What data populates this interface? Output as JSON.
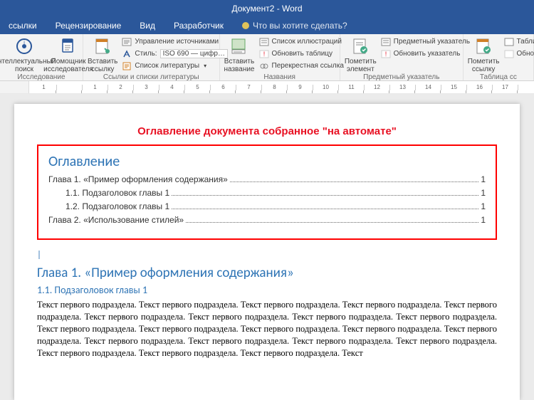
{
  "titlebar": {
    "text": "Документ2 - Word"
  },
  "tabs": {
    "links": "ссылки",
    "review": "Рецензирование",
    "view": "Вид",
    "developer": "Разработчик",
    "tellme": "Что вы хотите сделать?"
  },
  "ribbon": {
    "research": {
      "title": "Исследование",
      "smart_lookup": "Интеллектуальный\nпоиск",
      "researcher": "Помощник\nисследователя"
    },
    "citations": {
      "title": "Ссылки и списки литературы",
      "insert_citation": "Вставить\nссылку",
      "manage_sources": "Управление источниками",
      "style_label": "Стиль:",
      "style_value": "ISO 690 — цифр…",
      "bibliography": "Список литературы"
    },
    "captions": {
      "title": "Названия",
      "insert_caption": "Вставить\nназвание",
      "table_of_figures": "Список иллюстраций",
      "update_table": "Обновить таблицу",
      "cross_ref": "Перекрестная ссылка"
    },
    "index": {
      "title": "Предметный указатель",
      "mark_entry": "Пометить\nэлемент",
      "insert_index": "Предметный указатель",
      "update_index": "Обновить указатель"
    },
    "authorities": {
      "title": "Таблица сс",
      "mark_citation": "Пометить\nссылку",
      "insert_toa": "Табли",
      "update_toa": "Обно"
    }
  },
  "ruler": [
    "1",
    "",
    "1",
    "2",
    "3",
    "4",
    "5",
    "6",
    "7",
    "8",
    "9",
    "10",
    "11",
    "12",
    "13",
    "14",
    "15",
    "16",
    "17"
  ],
  "document": {
    "red_title": "Оглавление документа собранное \"на автомате\"",
    "toc_heading": "Оглавление",
    "toc": [
      {
        "text": "Глава 1. «Пример оформления содержания»",
        "page": "1",
        "indent": false
      },
      {
        "text": "1.1. Подзаголовок главы 1",
        "page": "1",
        "indent": true
      },
      {
        "text": "1.2. Подзаголовок главы 1",
        "page": "1",
        "indent": true
      },
      {
        "text": "Глава 2. «Использование стилей»",
        "page": "1",
        "indent": false
      }
    ],
    "cursor": "|",
    "h1": "Глава 1. «Пример оформления содержания»",
    "h2": "1.1. Подзаголовок главы 1",
    "body": "Текст первого подраздела. Текст первого подраздела. Текст первого подраздела. Текст первого подраздела. Текст первого подраздела. Текст первого подраздела. Текст первого подраздела. Текст первого подраздела. Текст первого подраздела. Текст первого подраздела. Текст первого подраздела. Текст первого подраздела. Текст первого подраздела. Текст первого подраздела. Текст первого подраздела. Текст первого подраздела. Текст первого подраздела. Текст первого подраздела. Текст первого подраздела. Текст первого подраздела. Текст первого подраздела. Текст"
  }
}
